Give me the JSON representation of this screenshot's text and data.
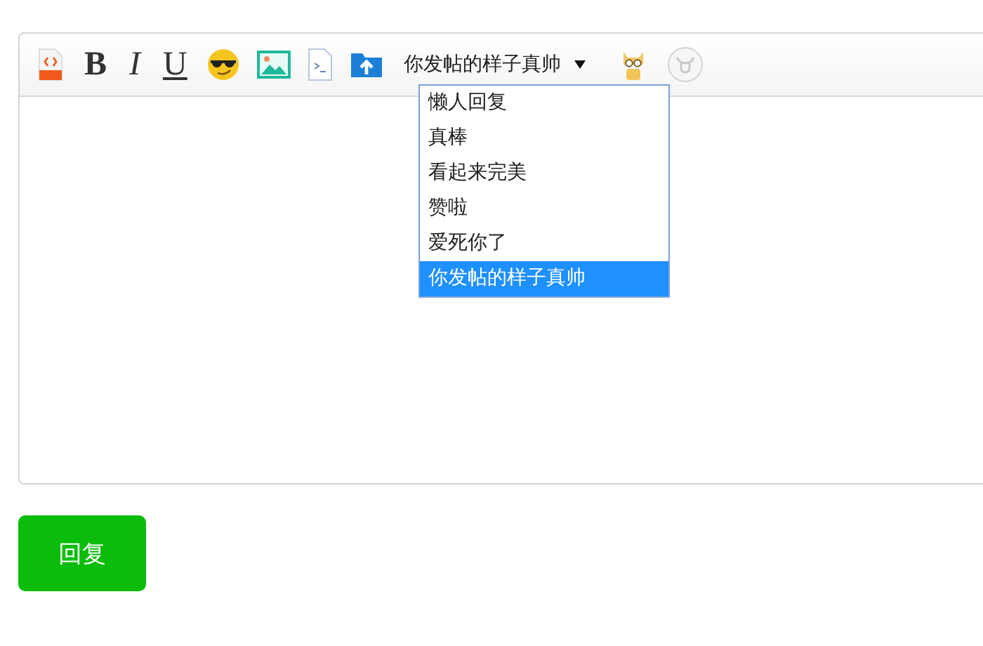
{
  "toolbar": {
    "bold": "B",
    "italic": "I",
    "underline": "U",
    "select": {
      "value": "你发帖的样子真帅",
      "expanded": true,
      "options": [
        {
          "label": "懒人回复",
          "selected": false
        },
        {
          "label": "真棒",
          "selected": false
        },
        {
          "label": "看起来完美",
          "selected": false
        },
        {
          "label": "赞啦",
          "selected": false
        },
        {
          "label": "爱死你了",
          "selected": false
        },
        {
          "label": "你发帖的样子真帅",
          "selected": true
        }
      ]
    }
  },
  "submit_button": "回复"
}
